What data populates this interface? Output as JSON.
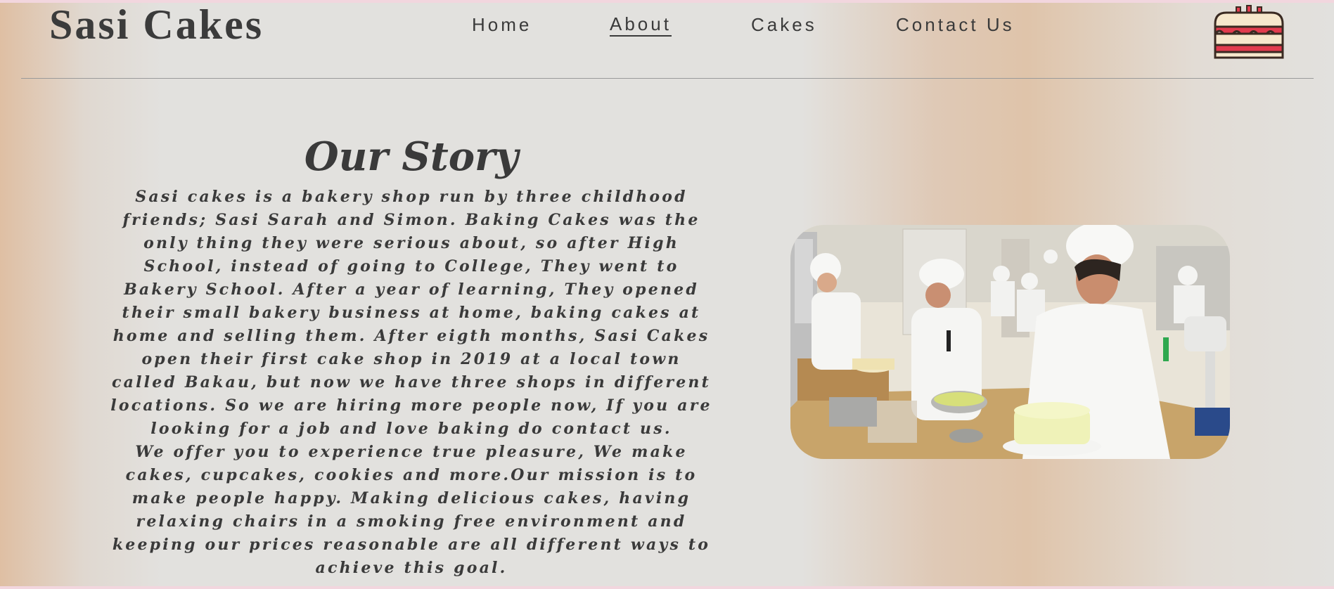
{
  "header": {
    "brand": "Sasi Cakes",
    "nav": [
      {
        "label": "Home",
        "active": false
      },
      {
        "label": "About",
        "active": true
      },
      {
        "label": "Cakes",
        "active": false
      },
      {
        "label": "Contact Us",
        "active": false
      }
    ],
    "logo_icon": "cake-icon"
  },
  "story": {
    "title": "Our Story",
    "paragraph1": "Sasi cakes is a bakery shop run by three childhood friends; Sasi Sarah and Simon. Baking Cakes was the only thing they were serious about, so after High School, instead of going to College, They went to Bakery School. After a year of learning, They opened their small bakery business at home, baking cakes at home and selling them. After eigth months, Sasi Cakes open their first cake shop in 2019 at a local town called Bakau, but now we have three shops in different locations. So we are hiring more people now, If you are looking for a job and love baking do contact us.",
    "paragraph2": "We offer you to experience true pleasure, We make cakes, cupcakes, cookies and more.Our mission is to make people happy. Making delicious cakes, having relaxing chairs in a smoking free environment and keeping our prices reasonable are all different ways to achieve this goal."
  },
  "photo": {
    "subject": "bakery-kitchen-photo"
  },
  "colors": {
    "text": "#3a3a3a",
    "background": "#e2e1de",
    "accent_peach": "#dfc4aa",
    "cake_red": "#e23b4e"
  }
}
